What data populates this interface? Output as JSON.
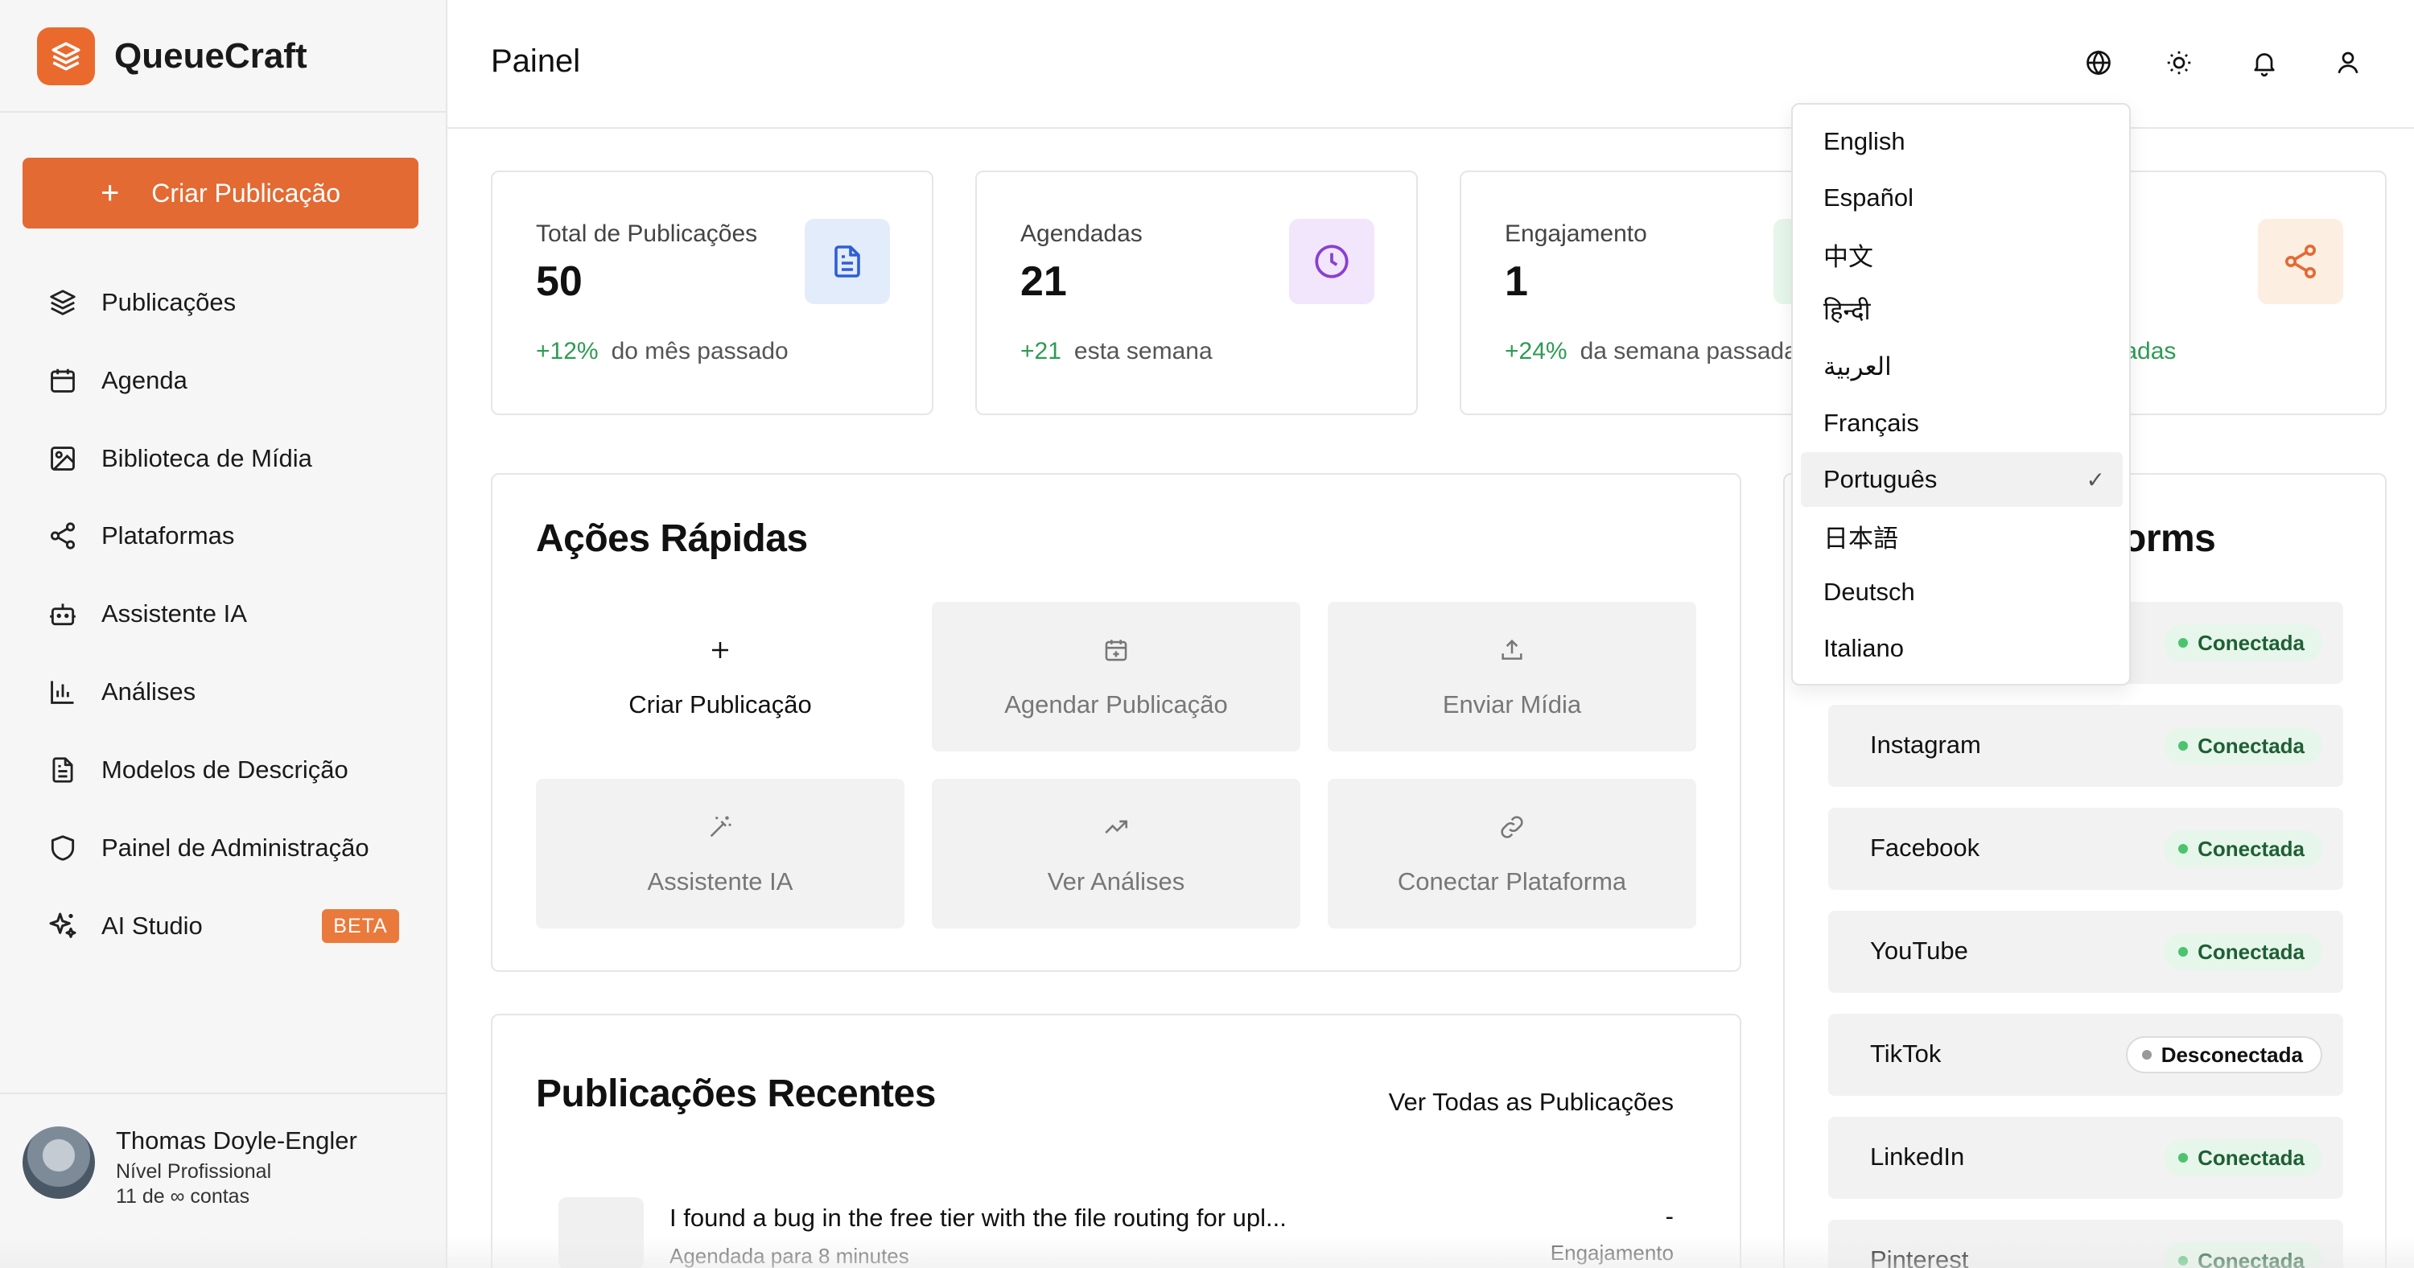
{
  "app": {
    "name": "QueueCraft"
  },
  "sidebar": {
    "create_label": "Criar Publicação",
    "items": [
      {
        "label": "Publicações",
        "icon": "layers-icon"
      },
      {
        "label": "Agenda",
        "icon": "calendar-icon"
      },
      {
        "label": "Biblioteca de Mídia",
        "icon": "image-icon"
      },
      {
        "label": "Plataformas",
        "icon": "share-icon"
      },
      {
        "label": "Assistente IA",
        "icon": "robot-icon"
      },
      {
        "label": "Análises",
        "icon": "bar-chart-icon"
      },
      {
        "label": "Modelos de Descrição",
        "icon": "document-icon"
      },
      {
        "label": "Painel de Administração",
        "icon": "shield-icon"
      },
      {
        "label": "AI Studio",
        "icon": "sparkles-icon"
      }
    ],
    "beta_badge": "BETA",
    "user": {
      "name": "Thomas Doyle-Engler",
      "tier": "Nível Profissional",
      "accounts": "11 de ∞ contas"
    }
  },
  "header": {
    "title": "Painel",
    "icons": [
      "globe-icon",
      "sun-icon",
      "bell-icon",
      "user-icon"
    ]
  },
  "stats": [
    {
      "label": "Total de Publicações",
      "value": "50",
      "delta": "+12%",
      "note": "do mês passado",
      "icon": "document-icon",
      "icon_bg": "#e3ecfb",
      "icon_color": "#2f5fd6"
    },
    {
      "label": "Agendadas",
      "value": "21",
      "delta": "+21",
      "note": "esta semana",
      "icon": "clock-icon",
      "icon_bg": "#f1e6fb",
      "icon_color": "#8a3fd1"
    },
    {
      "label": "Engajamento",
      "value": "1",
      "delta": "+24%",
      "note": "da semana passada",
      "icon": "trend-icon",
      "icon_bg": "#e6f6ea",
      "icon_color": "#2e9b54"
    },
    {
      "label": "",
      "value": "",
      "delta": "",
      "note": "ctadas",
      "icon": "share-icon",
      "icon_bg": "#fdeee2",
      "icon_color": "#e36a33"
    }
  ],
  "quick_actions": {
    "title": "Ações Rápidas",
    "items": [
      {
        "label": "Criar Publicação",
        "icon": "plus-icon"
      },
      {
        "label": "Agendar Publicação",
        "icon": "calendar-plus-icon"
      },
      {
        "label": "Enviar Mídia",
        "icon": "upload-icon"
      },
      {
        "label": "Assistente IA",
        "icon": "magic-wand-icon"
      },
      {
        "label": "Ver Análises",
        "icon": "trending-up-icon"
      },
      {
        "label": "Conectar Plataforma",
        "icon": "link-icon"
      }
    ]
  },
  "platforms": {
    "title_partial": "orms",
    "items": [
      {
        "name": "",
        "status": "Conectada",
        "connected": true
      },
      {
        "name": "Instagram",
        "status": "Conectada",
        "connected": true
      },
      {
        "name": "Facebook",
        "status": "Conectada",
        "connected": true
      },
      {
        "name": "YouTube",
        "status": "Conectada",
        "connected": true
      },
      {
        "name": "TikTok",
        "status": "Desconectada",
        "connected": false
      },
      {
        "name": "LinkedIn",
        "status": "Conectada",
        "connected": true
      },
      {
        "name": "Pinterest",
        "status": "Conectada",
        "connected": true
      }
    ]
  },
  "recent": {
    "title": "Publicações Recentes",
    "view_all": "Ver Todas as Publicações",
    "posts": [
      {
        "title": "I found a bug in the free tier with the file routing for upl...",
        "subtitle": "Agendada para 8 minutes",
        "metric": "-",
        "metric_label": "Engajamento"
      }
    ]
  },
  "language_menu": {
    "selected": "Português",
    "check": "✓",
    "options": [
      "English",
      "Español",
      "中文",
      "हिन्दी",
      "العربية",
      "Français",
      "Português",
      "日本語",
      "Deutsch",
      "Italiano"
    ]
  },
  "colors": {
    "accent": "#e36a33",
    "success": "#2e9b54"
  }
}
